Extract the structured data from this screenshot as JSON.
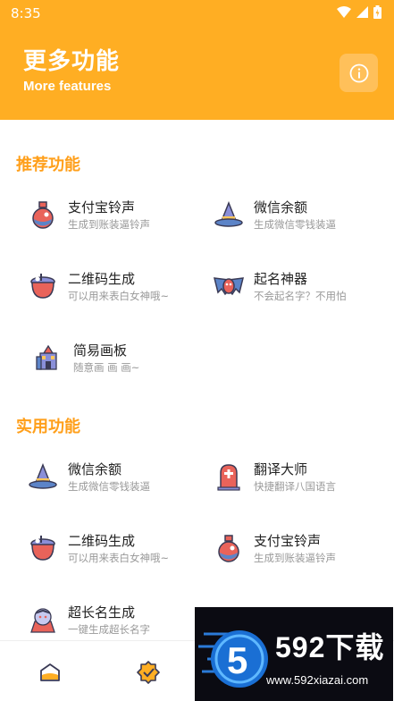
{
  "status": {
    "time": "8:35"
  },
  "header": {
    "title": "更多功能",
    "subtitle": "More features"
  },
  "sections": {
    "recommended": {
      "title": "推荐功能",
      "items": [
        {
          "name": "支付宝铃声",
          "desc": "生成到账装逼铃声",
          "icon": "potion-icon"
        },
        {
          "name": "微信余额",
          "desc": "生成微信零钱装逼",
          "icon": "wizard-hat-icon"
        },
        {
          "name": "二维码生成",
          "desc": "可以用来表白女神哦~",
          "icon": "cauldron-icon"
        },
        {
          "name": "起名神器",
          "desc": "不会起名字？不用怕",
          "icon": "bat-icon"
        },
        {
          "name": "简易画板",
          "desc": "随意画 画 画~",
          "icon": "haunted-house-icon"
        }
      ]
    },
    "practical": {
      "title": "实用功能",
      "items": [
        {
          "name": "微信余额",
          "desc": "生成微信零钱装逼",
          "icon": "wizard-hat-icon"
        },
        {
          "name": "翻译大师",
          "desc": "快捷翻译八国语言",
          "icon": "tombstone-icon"
        },
        {
          "name": "二维码生成",
          "desc": "可以用来表白女神哦~",
          "icon": "cauldron-icon"
        },
        {
          "name": "支付宝铃声",
          "desc": "生成到账装逼铃声",
          "icon": "potion-icon"
        },
        {
          "name": "超长名生成",
          "desc": "一键生成超长名字",
          "icon": "vampire-icon"
        }
      ]
    }
  },
  "tabbar": {
    "tabs": [
      "home-tab",
      "verified-tab"
    ]
  },
  "watermark": {
    "brand": "592下载",
    "url": "www.592xiazai.com",
    "badge": "5"
  },
  "colors": {
    "accent": "#ffae23",
    "section": "#ff9f1a"
  }
}
